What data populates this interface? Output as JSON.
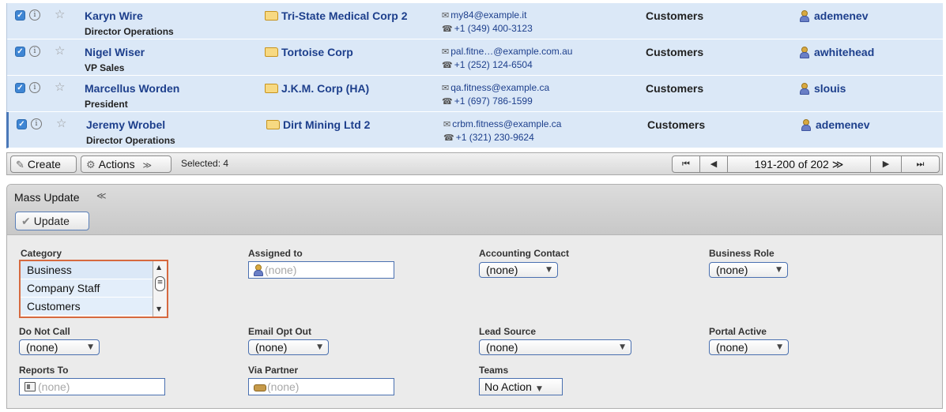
{
  "rows": [
    {
      "name": "Karyn Wire",
      "title": "Director Operations",
      "account": "Tri-State Medical Corp 2",
      "email": "my84@example.it",
      "phone": "+1 (349) 400-3123",
      "type": "Customers",
      "user": "ademenev"
    },
    {
      "name": "Nigel Wiser",
      "title": "VP Sales",
      "account": "Tortoise Corp",
      "email": "pal.fitne…@example.com.au",
      "phone": "+1 (252) 124-6504",
      "type": "Customers",
      "user": "awhitehead"
    },
    {
      "name": "Marcellus Worden",
      "title": "President",
      "account": "J.K.M. Corp (HA)",
      "email": "qa.fitness@example.ca",
      "phone": "+1 (697) 786-1599",
      "type": "Customers",
      "user": "slouis"
    },
    {
      "name": "Jeremy Wrobel",
      "title": "Director Operations",
      "account": "Dirt Mining Ltd 2",
      "email": "crbm.fitness@example.ca",
      "phone": "+1 (321) 230-9624",
      "type": "Customers",
      "user": "ademenev"
    }
  ],
  "toolbar": {
    "create_label": "Create",
    "actions_label": "Actions",
    "actions_chevron": "≫",
    "selected_text": "Selected: 4",
    "pager_first": "⏮",
    "pager_prev": "◀",
    "pager_range": "191-200 of 202 ≫",
    "pager_next": "▶",
    "pager_last": "⏭"
  },
  "mass_update": {
    "title": "Mass Update",
    "collapse_icon": "≪",
    "update_label": "Update",
    "fields": {
      "category": {
        "label": "Category",
        "options": [
          "Business",
          "Company Staff",
          "Customers"
        ]
      },
      "assigned_to": {
        "label": "Assigned to",
        "placeholder": "(none)"
      },
      "accounting_contact": {
        "label": "Accounting Contact",
        "value": "(none)"
      },
      "business_role": {
        "label": "Business Role",
        "value": "(none)"
      },
      "do_not_call": {
        "label": "Do Not Call",
        "value": "(none)"
      },
      "email_opt_out": {
        "label": "Email Opt Out",
        "value": "(none)"
      },
      "lead_source": {
        "label": "Lead Source",
        "value": "(none)"
      },
      "portal_active": {
        "label": "Portal Active",
        "value": "(none)"
      },
      "reports_to": {
        "label": "Reports To",
        "placeholder": "(none)"
      },
      "via_partner": {
        "label": "Via Partner",
        "placeholder": "(none)"
      },
      "teams": {
        "label": "Teams",
        "value": "No Action"
      }
    }
  },
  "colors": {
    "row_bg": "#dbe8f7",
    "link": "#1d3f8c",
    "accent_border": "#4a70b0",
    "category_border": "#d6693f"
  },
  "icons": [
    "checkbox-icon",
    "info-icon",
    "star-icon",
    "folder-icon",
    "envelope-icon",
    "phone-icon",
    "user-icon",
    "pencil-icon",
    "gear-icon",
    "checkmark-icon",
    "card-icon",
    "handshake-icon"
  ]
}
